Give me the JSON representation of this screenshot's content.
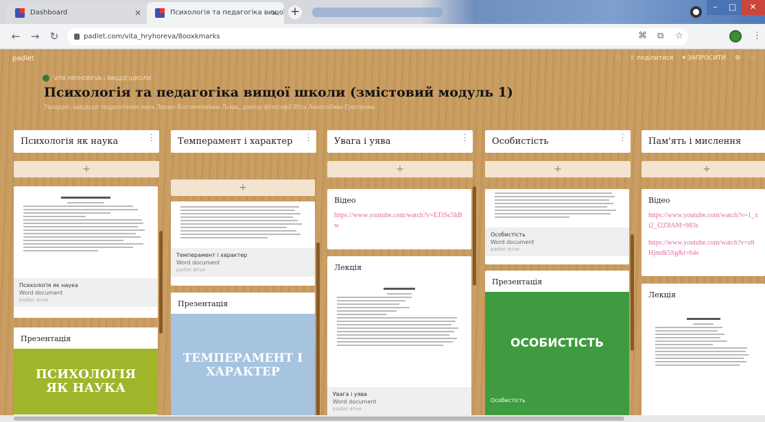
{
  "browser": {
    "tabs": [
      {
        "title": "Dashboard"
      },
      {
        "title": "Психологія та педагогіка вищої"
      }
    ],
    "url": "padlet.com/vita_hryhoreva/8ooxkmarks"
  },
  "app": {
    "brand": "padlet",
    "top_actions": [
      "♡",
      "⇪ поділитися",
      "▾ ЗАПРОСИТИ",
      "⚙",
      "⋯"
    ],
    "breadcrumb": "VITA HRYHOREVA  ›  ВИЩОЇ ШКОЛИ",
    "title": "Психологія та педагогіка вищої школи (змістовий модуль 1)",
    "subtitle": "Укладачі: кандидат педагогічних наук Ляшко Костянтинівна Лєвас, доктор філософії Віта Анатоліївна Григорова"
  },
  "columns": [
    {
      "title": "Психологія як наука"
    },
    {
      "title": "Темперамент і характер"
    },
    {
      "title": "Увага і уява"
    },
    {
      "title": "Особистість"
    },
    {
      "title": "Пам'ять і мислення"
    }
  ],
  "col_add": "+",
  "cards": {
    "c1_doc": {
      "name": "Психологія як наука",
      "kind": "Word document",
      "src": "padlet drive"
    },
    "c1_pres": {
      "title": "Презентація",
      "banner": "ПСИХОЛОГІЯ ЯК НАУКА"
    },
    "c2_doc": {
      "name": "Темперамент і характер",
      "kind": "Word document",
      "src": "padlet drive"
    },
    "c2_pres": {
      "title": "Презентація",
      "banner": "ТЕМПЕРАМЕНТ І ХАРАКТЕР"
    },
    "c3_video": {
      "title": "Відео",
      "link": "https://www.youtube.com/watch?v=EJ3Sc5hBw"
    },
    "c3_lecture": {
      "title": "Лекція",
      "name": "Увага і уява",
      "kind": "Word document",
      "src": "padlet drive"
    },
    "c4_doc": {
      "name": "Особистість",
      "kind": "Word document",
      "src": "padlet drive"
    },
    "c4_pres": {
      "title": "Презентація",
      "banner": "ОСОБИСТІСТЬ",
      "footer": "Особистість"
    },
    "c5_video": {
      "title": "Відео",
      "link1": "https://www.youtube.com/watch?v=1_xi2_f2Z8AM=983s",
      "link2": "https://www.youtube.com/watch?v=z8Hjmdk5Sg&t=64s"
    },
    "c5_lecture": {
      "title": "Лекція"
    }
  },
  "colors": {
    "wood": "#c99b5e",
    "green_banner": "#3f9b3f",
    "olive_banner": "#9fb62a",
    "blue_banner": "#a6c3df",
    "link_pink": "#e06aa0"
  }
}
